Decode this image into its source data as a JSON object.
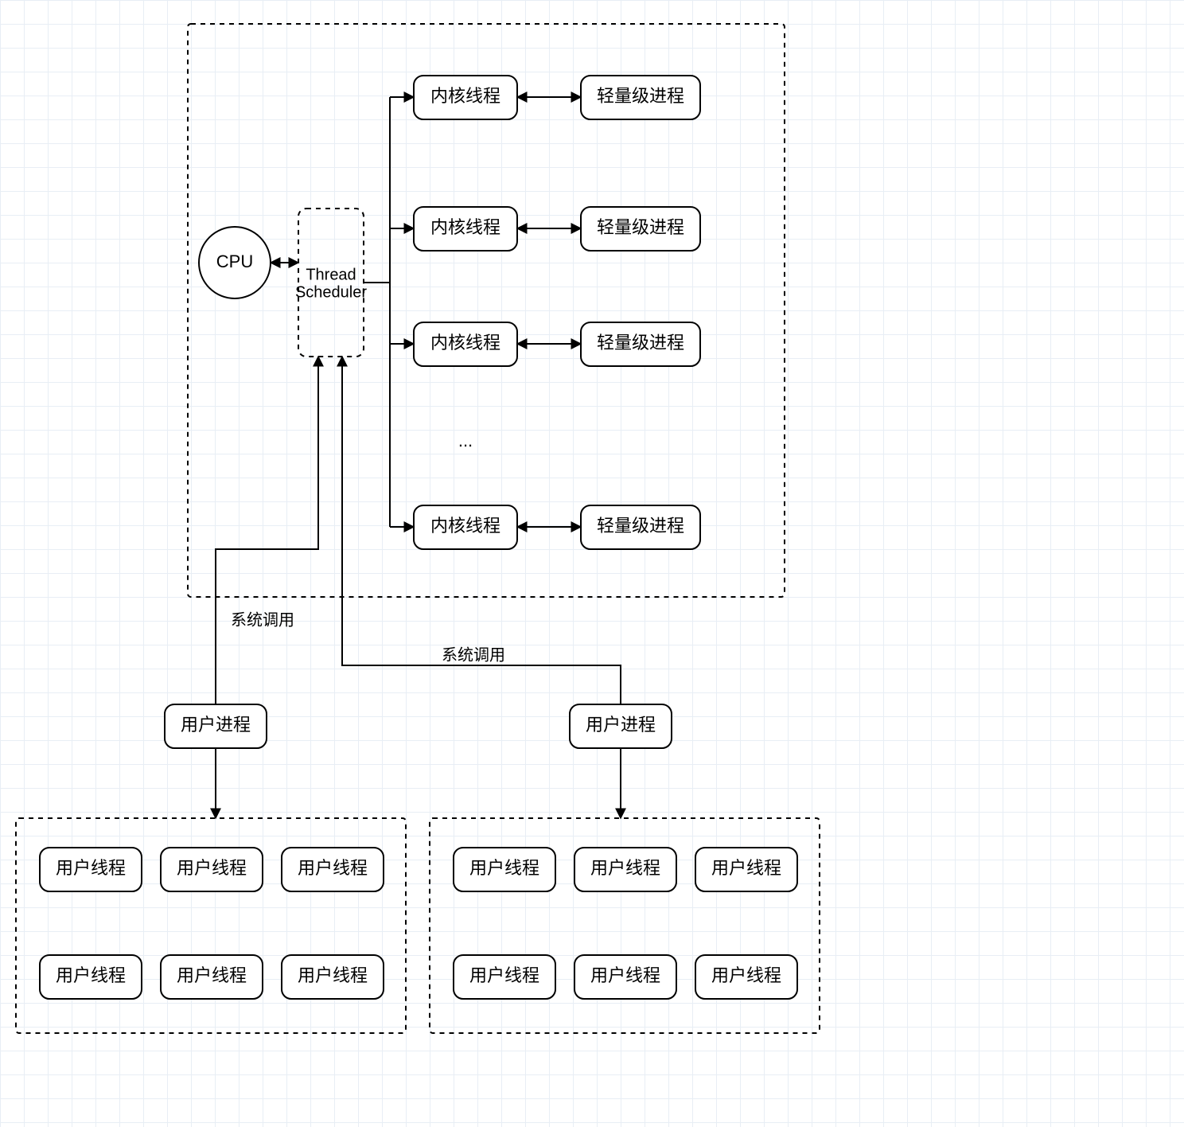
{
  "cpu": "CPU",
  "scheduler": {
    "l1": "Thread",
    "l2": "Scheduler"
  },
  "kernel_thread": "内核线程",
  "light_process": "轻量级进程",
  "ellipsis": "...",
  "syscall": "系统调用",
  "user_process": "用户进程",
  "user_thread": "用户线程",
  "chart_data": {
    "type": "diagram",
    "description": "Hybrid threading model: CPU feeds Thread Scheduler inside kernel box; kernel threads map to lightweight processes; two user processes (via system calls) each own a group of six user threads.",
    "nodes": [
      {
        "id": "cpu",
        "label": "CPU",
        "kind": "cpu"
      },
      {
        "id": "scheduler",
        "label": "Thread Scheduler",
        "kind": "scheduler"
      },
      {
        "id": "kt1",
        "label": "内核线程",
        "kind": "kernel-thread"
      },
      {
        "id": "kt2",
        "label": "内核线程",
        "kind": "kernel-thread"
      },
      {
        "id": "kt3",
        "label": "内核线程",
        "kind": "kernel-thread"
      },
      {
        "id": "kt4",
        "label": "内核线程",
        "kind": "kernel-thread"
      },
      {
        "id": "lp1",
        "label": "轻量级进程",
        "kind": "light-process"
      },
      {
        "id": "lp2",
        "label": "轻量级进程",
        "kind": "light-process"
      },
      {
        "id": "lp3",
        "label": "轻量级进程",
        "kind": "light-process"
      },
      {
        "id": "lp4",
        "label": "轻量级进程",
        "kind": "light-process"
      },
      {
        "id": "up1",
        "label": "用户进程",
        "kind": "user-process"
      },
      {
        "id": "up2",
        "label": "用户进程",
        "kind": "user-process"
      },
      {
        "id": "ut_l_1",
        "label": "用户线程",
        "kind": "user-thread",
        "group": "left"
      },
      {
        "id": "ut_l_2",
        "label": "用户线程",
        "kind": "user-thread",
        "group": "left"
      },
      {
        "id": "ut_l_3",
        "label": "用户线程",
        "kind": "user-thread",
        "group": "left"
      },
      {
        "id": "ut_l_4",
        "label": "用户线程",
        "kind": "user-thread",
        "group": "left"
      },
      {
        "id": "ut_l_5",
        "label": "用户线程",
        "kind": "user-thread",
        "group": "left"
      },
      {
        "id": "ut_l_6",
        "label": "用户线程",
        "kind": "user-thread",
        "group": "left"
      },
      {
        "id": "ut_r_1",
        "label": "用户线程",
        "kind": "user-thread",
        "group": "right"
      },
      {
        "id": "ut_r_2",
        "label": "用户线程",
        "kind": "user-thread",
        "group": "right"
      },
      {
        "id": "ut_r_3",
        "label": "用户线程",
        "kind": "user-thread",
        "group": "right"
      },
      {
        "id": "ut_r_4",
        "label": "用户线程",
        "kind": "user-thread",
        "group": "right"
      },
      {
        "id": "ut_r_5",
        "label": "用户线程",
        "kind": "user-thread",
        "group": "right"
      },
      {
        "id": "ut_r_6",
        "label": "用户线程",
        "kind": "user-thread",
        "group": "right"
      }
    ],
    "edges": [
      {
        "from": "cpu",
        "to": "scheduler",
        "dir": "both"
      },
      {
        "from": "scheduler",
        "to": "kt1"
      },
      {
        "from": "scheduler",
        "to": "kt2"
      },
      {
        "from": "scheduler",
        "to": "kt3"
      },
      {
        "from": "scheduler",
        "to": "kt4"
      },
      {
        "from": "kt1",
        "to": "lp1",
        "dir": "both"
      },
      {
        "from": "kt2",
        "to": "lp2",
        "dir": "both"
      },
      {
        "from": "kt3",
        "to": "lp3",
        "dir": "both"
      },
      {
        "from": "kt4",
        "to": "lp4",
        "dir": "both"
      },
      {
        "from": "up1",
        "to": "scheduler",
        "label": "系统调用",
        "dir": "to"
      },
      {
        "from": "up2",
        "to": "scheduler",
        "label": "系统调用",
        "dir": "to"
      },
      {
        "from": "up1",
        "to": "user-threads-left",
        "dir": "to"
      },
      {
        "from": "up2",
        "to": "user-threads-right",
        "dir": "to"
      }
    ],
    "containers": [
      {
        "id": "kernel-box",
        "contains": [
          "scheduler",
          "kt1",
          "kt2",
          "kt3",
          "kt4",
          "lp1",
          "lp2",
          "lp3",
          "lp4"
        ]
      },
      {
        "id": "user-threads-left",
        "contains": [
          "ut_l_1",
          "ut_l_2",
          "ut_l_3",
          "ut_l_4",
          "ut_l_5",
          "ut_l_6"
        ]
      },
      {
        "id": "user-threads-right",
        "contains": [
          "ut_r_1",
          "ut_r_2",
          "ut_r_3",
          "ut_r_4",
          "ut_r_5",
          "ut_r_6"
        ]
      }
    ]
  }
}
